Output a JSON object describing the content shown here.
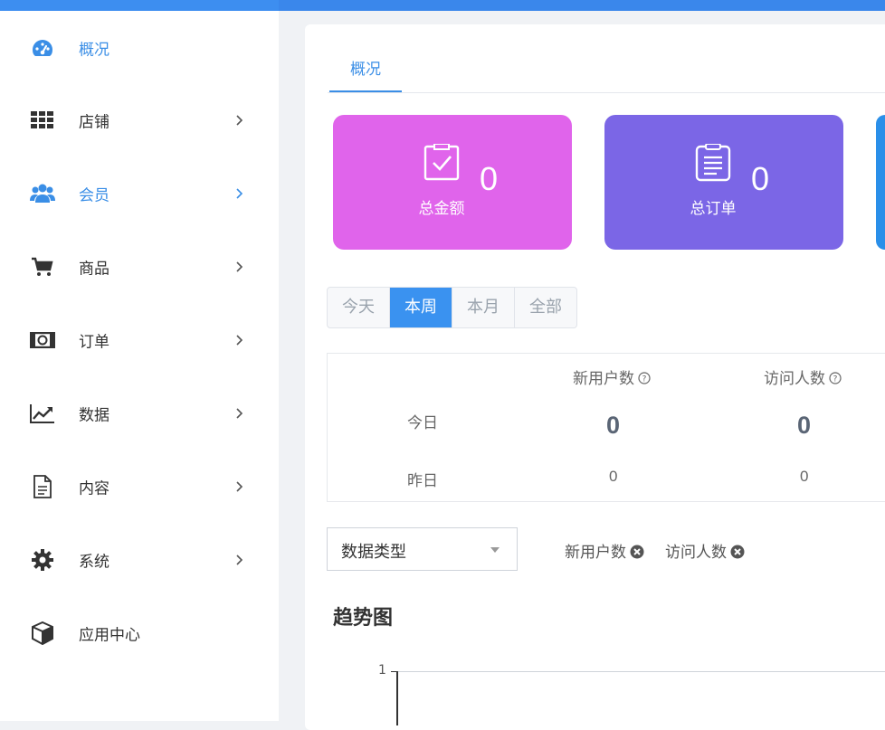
{
  "sidebar": {
    "items": [
      {
        "label": "概况",
        "icon": "dashboard-gauge-icon",
        "active": true
      },
      {
        "label": "店铺",
        "icon": "grid-apps-icon"
      },
      {
        "label": "会员",
        "icon": "users-group-icon",
        "active": true
      },
      {
        "label": "商品",
        "icon": "shopping-cart-icon"
      },
      {
        "label": "订单",
        "icon": "money-bill-icon"
      },
      {
        "label": "数据",
        "icon": "line-chart-icon"
      },
      {
        "label": "内容",
        "icon": "document-icon"
      },
      {
        "label": "系统",
        "icon": "gear-icon"
      },
      {
        "label": "应用中心",
        "icon": "cube-icon"
      }
    ]
  },
  "main": {
    "tab": "概况",
    "cards": [
      {
        "label": "总金额",
        "value": "0",
        "color": "#e064eb",
        "icon": "checkbox-clipboard-icon"
      },
      {
        "label": "总订单",
        "value": "0",
        "color": "#7b66e6",
        "icon": "list-clipboard-icon"
      }
    ],
    "periods": [
      "今天",
      "本周",
      "本月",
      "全部"
    ],
    "period_selected": "本周",
    "stats": {
      "col1_header": "新用户数",
      "col2_header": "访问人数",
      "row_today": "今日",
      "row_yesterday": "昨日",
      "today_col1": "0",
      "today_col2": "0",
      "yesterday_col1": "0",
      "yesterday_col2": "0"
    },
    "data_type_select": "数据类型",
    "tags": [
      "新用户数",
      "访问人数"
    ],
    "trend_title": "趋势图",
    "y_tick_top": "1"
  },
  "colors": {
    "accent": "#3a8ee6",
    "topbar": "#3d8ef0"
  }
}
